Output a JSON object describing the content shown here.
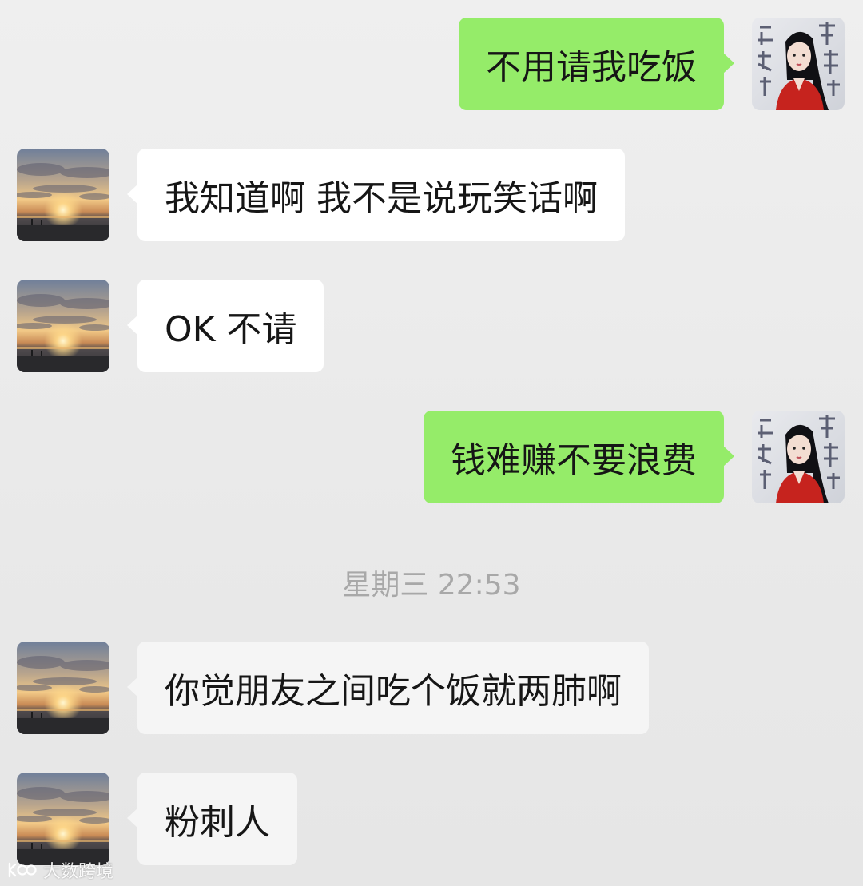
{
  "conversation": {
    "messages": [
      {
        "direction": "out",
        "text": "不用请我吃饭"
      },
      {
        "direction": "in",
        "text": "我知道啊 我不是说玩笑话啊"
      },
      {
        "direction": "in",
        "text": "OK 不请"
      },
      {
        "direction": "out",
        "text": "钱难赚不要浪费"
      },
      {
        "direction": "in",
        "text": "你觉朋友之间吃个饭就两肺啊"
      },
      {
        "direction": "in",
        "text": "粉刺人"
      }
    ],
    "timestamp": "星期三 22:53"
  },
  "avatars": {
    "self": "portrait-avatar",
    "contact": "sunset-avatar"
  },
  "watermark": {
    "logo": "watermark-logo-icon",
    "text": "大数跨境"
  },
  "colors": {
    "outgoing_bubble": "#95ec69",
    "incoming_bubble": "#ffffff",
    "background": "#ededed",
    "timestamp": "#a8a8a8"
  }
}
